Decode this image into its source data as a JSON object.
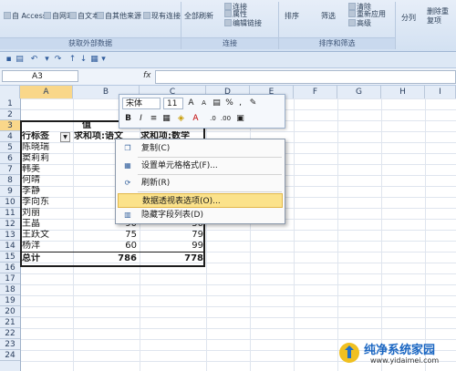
{
  "ribbon": {
    "items": {
      "access": "自 Access",
      "web": "自网站",
      "text": "自文本",
      "other": "自其他来源",
      "existing": "现有连接",
      "refresh_all": "全部刷新",
      "connections": "连接",
      "properties": "属性",
      "edit_links": "编辑链接",
      "sort": "排序",
      "filter": "筛选",
      "clear": "清除",
      "reapply": "重新应用",
      "advanced": "高级",
      "split": "分列",
      "remove_dup": "删除重复项"
    },
    "groups": {
      "external": "获取外部数据",
      "connections": "连接",
      "sort_filter": "排序和筛选"
    }
  },
  "formula_bar": {
    "cell_ref": "A3",
    "fx": "fx",
    "formula": ""
  },
  "columns": [
    "A",
    "B",
    "C",
    "D",
    "E",
    "F",
    "G",
    "H",
    "I"
  ],
  "rows": [
    "1",
    "2",
    "3",
    "4",
    "5",
    "6",
    "7",
    "8",
    "9",
    "10",
    "11",
    "12",
    "13",
    "14",
    "15",
    "16",
    "17",
    "18",
    "19",
    "20",
    "21",
    "22",
    "23",
    "24"
  ],
  "pivot": {
    "values_label": "值",
    "row_label_header": "行标签",
    "col_b_header": "求和项:语文",
    "col_c_header": "求和项:数学",
    "names": [
      "陈晓瑞",
      "窦莉莉",
      "韩美",
      "何晴",
      "李静",
      "李向东",
      "刘丽",
      "王晶",
      "王跃文",
      "杨洋"
    ],
    "b_visible": [
      "90",
      "75",
      "60"
    ],
    "c_visible": [
      "50",
      "79",
      "99"
    ],
    "total_label": "总计",
    "total_b": "786",
    "total_c": "778"
  },
  "mini_toolbar": {
    "font": "宋体",
    "size": "11"
  },
  "context_menu": {
    "copy": "复制(C)",
    "format_cells": "设置单元格格式(F)...",
    "refresh": "刷新(R)",
    "pivot_options": "数据透视表选项(O)...",
    "hide_field_list": "隐藏字段列表(D)"
  },
  "watermark": {
    "title": "纯净系统家园",
    "url": "www.yidaimei.com"
  }
}
